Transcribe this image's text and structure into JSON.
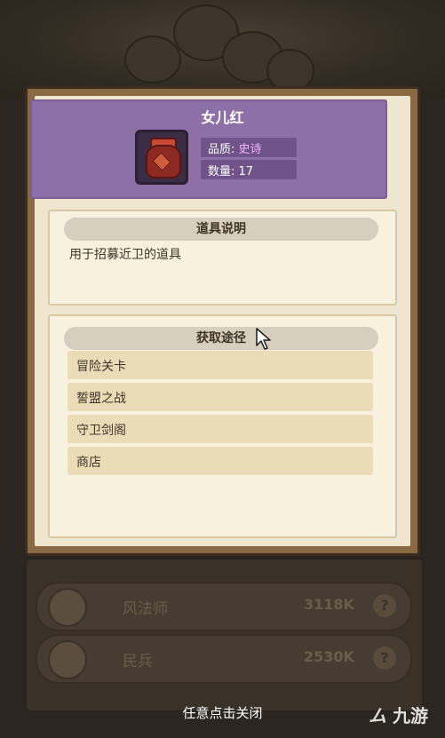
{
  "item": {
    "name": "女儿红",
    "quality_label": "品质:",
    "quality_value": "史诗",
    "quantity_label": "数量:",
    "quantity_value": "17"
  },
  "description": {
    "header": "道具说明",
    "text": "用于招募近卫的道具"
  },
  "sources": {
    "header": "获取途径",
    "items": [
      "冒险关卡",
      "誓盟之战",
      "守卫剑阁",
      "商店"
    ]
  },
  "background_list": [
    {
      "name": "风法师",
      "power": "3118K",
      "help_icon": "?"
    },
    {
      "name": "民兵",
      "power": "2530K",
      "help_icon": "?"
    }
  ],
  "close_hint": "任意点击关闭",
  "watermark": {
    "mark": "ム",
    "text": "九游"
  },
  "colors": {
    "banner": "#8e70a8",
    "panel_frame": "#8a6a45",
    "parchment": "#efe6cf",
    "source_item": "#ebdcb8",
    "epic_quality": "#f6b6ff"
  },
  "icons": {
    "item": "wine-jar-icon",
    "cursor": "mouse-cursor-icon"
  }
}
